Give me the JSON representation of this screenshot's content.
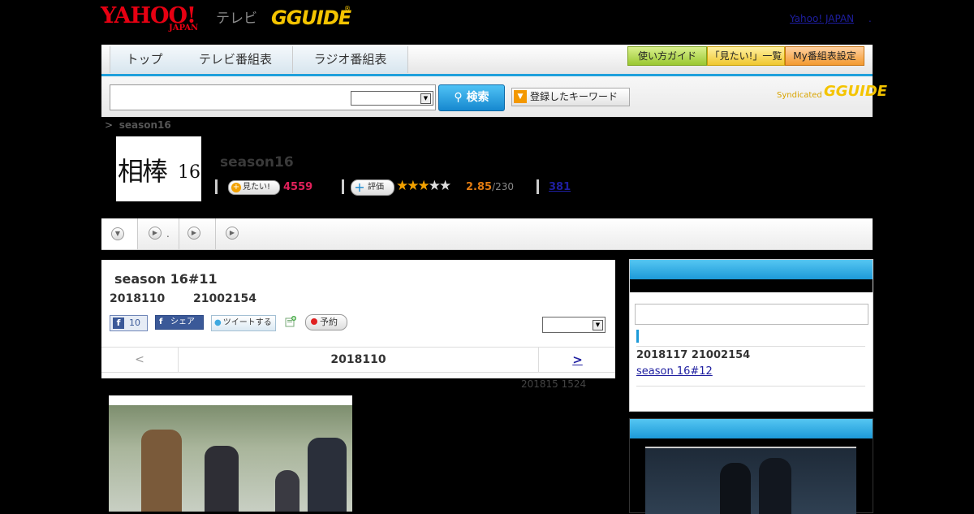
{
  "header": {
    "yahoo_logo": "YAHOO!",
    "yahoo_logo_sub": "JAPAN",
    "tv_label": "テレビ",
    "gguide_logo": "GUIDE",
    "gguide_reg": "®",
    "yahoo_japan_link": "Yahoo! JAPAN",
    "trailing_dot": "."
  },
  "nav": {
    "tabs": [
      {
        "label": "トップ"
      },
      {
        "label": "テレビ番組表"
      },
      {
        "label": "ラジオ番組表"
      }
    ],
    "right_buttons": [
      {
        "label": "使い方ガイド"
      },
      {
        "label": "「見たい!」一覧"
      },
      {
        "label": "My番組表設定"
      }
    ]
  },
  "search": {
    "input_value": "",
    "select_value": "",
    "button_label": "検索",
    "keyword_button_label": "登録したキーワード",
    "syndicated_label": "Syndicated",
    "syndicated_logo": "GUIDE"
  },
  "breadcrumb": {
    "separator": ">",
    "current": "season16"
  },
  "program": {
    "thumb_kanji": "相棒",
    "thumb_num": "16",
    "title": "season16",
    "mitai_label": "見たい!",
    "mitai_count": "4559",
    "hyoka_label": "評価",
    "rating": 2.85,
    "rating_text": "2.85",
    "rating_denominator": "/230",
    "rating_stars_max": 5,
    "review_count": "381"
  },
  "subtabs": [
    {
      "icon": "down-arrow-icon",
      "label": ""
    },
    {
      "icon": "play-icon",
      "label": "."
    },
    {
      "icon": "play-icon",
      "label": ""
    },
    {
      "icon": "play-icon",
      "label": ""
    }
  ],
  "episode": {
    "title": "season 16#11",
    "date": "2018110",
    "time": "21002154",
    "like_count": "10",
    "share_label": "シェア",
    "tweet_label": "ツイートする",
    "yoyaku_label": "予約",
    "select_value": "",
    "pager_prev": "<",
    "pager_current": "2018110",
    "pager_next": ">",
    "updated": "201815  1524"
  },
  "sidebar": {
    "next_date": "2018117  21002154",
    "next_title": " season 16#12 "
  },
  "colors": {
    "accent_blue": "#1d9ad8",
    "gguide_yellow": "#f4c400",
    "mitai_pink": "#e0205a",
    "score_orange": "#e07a10",
    "link_blue": "#1e1ea0"
  }
}
